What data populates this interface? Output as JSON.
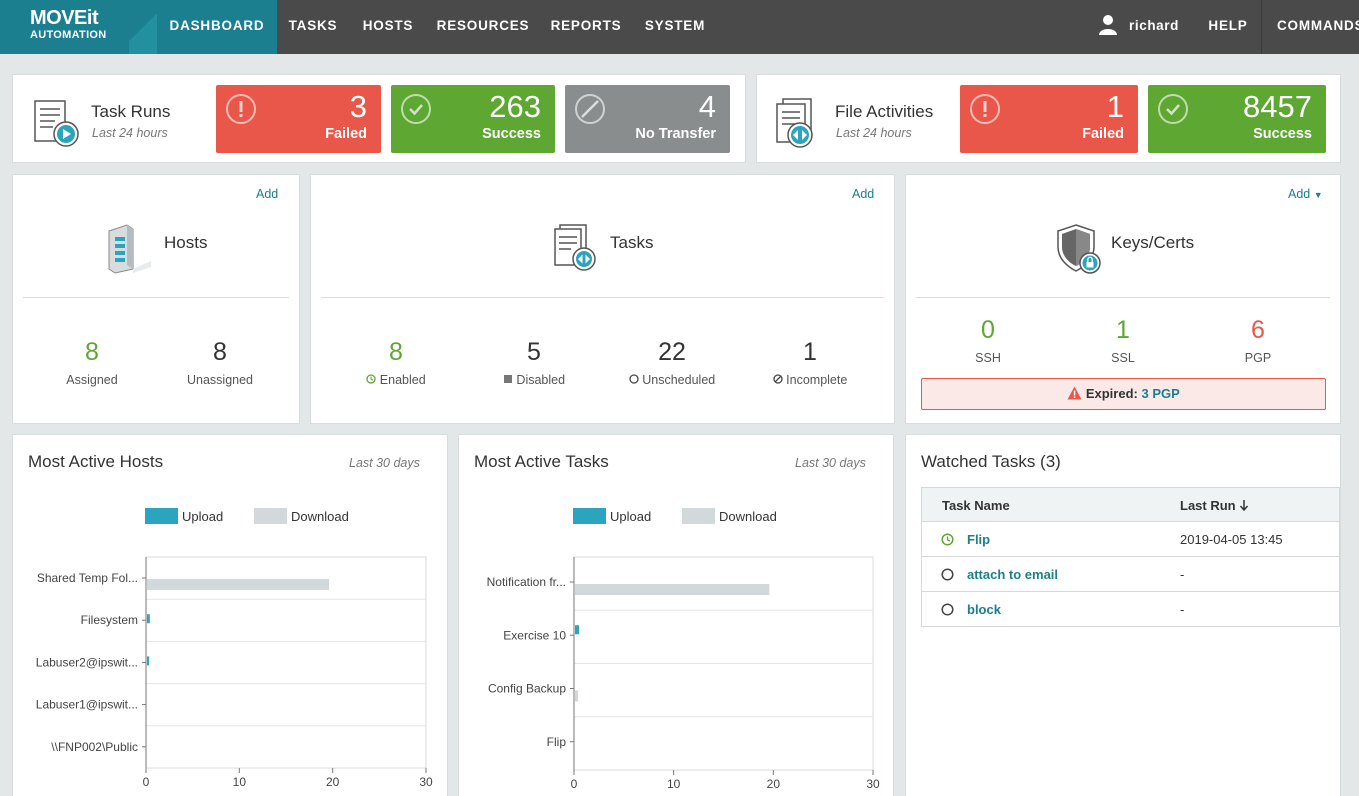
{
  "nav": {
    "logo_top": "MOVEit",
    "logo_bottom": "AUTOMATION",
    "items": [
      "DASHBOARD",
      "TASKS",
      "HOSTS",
      "RESOURCES",
      "REPORTS",
      "SYSTEM"
    ],
    "user": "richard",
    "help": "HELP",
    "commands": "COMMANDS"
  },
  "task_runs": {
    "title": "Task Runs",
    "subtitle": "Last 24 hours",
    "failed": {
      "value": "3",
      "label": "Failed"
    },
    "success": {
      "value": "263",
      "label": "Success"
    },
    "no_transfer": {
      "value": "4",
      "label": "No Transfer"
    }
  },
  "file_activities": {
    "title": "File Activities",
    "subtitle": "Last 24 hours",
    "failed": {
      "value": "1",
      "label": "Failed"
    },
    "success": {
      "value": "8457",
      "label": "Success"
    }
  },
  "hosts": {
    "title": "Hosts",
    "add": "Add",
    "assigned": {
      "value": "8",
      "label": "Assigned"
    },
    "unassigned": {
      "value": "8",
      "label": "Unassigned"
    }
  },
  "tasks": {
    "title": "Tasks",
    "add": "Add",
    "enabled": {
      "value": "8",
      "label": "Enabled"
    },
    "disabled": {
      "value": "5",
      "label": "Disabled"
    },
    "unscheduled": {
      "value": "22",
      "label": "Unscheduled"
    },
    "incomplete": {
      "value": "1",
      "label": "Incomplete"
    }
  },
  "keys": {
    "title": "Keys/Certs",
    "add": "Add",
    "ssh": {
      "value": "0",
      "label": "SSH"
    },
    "ssl": {
      "value": "1",
      "label": "SSL"
    },
    "pgp": {
      "value": "6",
      "label": "PGP"
    },
    "expired_label": "Expired:",
    "expired_link": "3 PGP"
  },
  "most_active_hosts": {
    "title": "Most Active Hosts",
    "range": "Last 30 days",
    "legend_upload": "Upload",
    "legend_download": "Download"
  },
  "most_active_tasks": {
    "title": "Most Active Tasks",
    "range": "Last 30 days",
    "legend_upload": "Upload",
    "legend_download": "Download"
  },
  "watched": {
    "title": "Watched Tasks (3)",
    "col_name": "Task Name",
    "col_last": "Last Run",
    "rows": [
      {
        "name": "Flip",
        "last": "2019-04-05 13:45"
      },
      {
        "name": "attach to email",
        "last": "-"
      },
      {
        "name": "block",
        "last": "-"
      }
    ]
  },
  "colors": {
    "upload": "#2ba4bd",
    "download": "#d3d9db",
    "accent": "#1b7f90"
  },
  "chart_data": [
    {
      "type": "bar",
      "categories": [
        "Shared Temp Fol...",
        "Filesystem",
        "Labuser2@ipswit...",
        "Labuser1@ipswit...",
        "\\\\FNP002\\Public"
      ],
      "series": [
        {
          "name": "Upload",
          "values": [
            0,
            0.3,
            0.2,
            0,
            0
          ]
        },
        {
          "name": "Download",
          "values": [
            19.5,
            0,
            0,
            0,
            0
          ]
        }
      ],
      "xlim": [
        0,
        30
      ],
      "xticks": [
        "0",
        "10",
        "20",
        "30"
      ]
    },
    {
      "type": "bar",
      "categories": [
        "Notification fr...",
        "Exercise 10",
        "Config Backup",
        "Flip"
      ],
      "series": [
        {
          "name": "Upload",
          "values": [
            0,
            0.4,
            0,
            0
          ]
        },
        {
          "name": "Download",
          "values": [
            19.5,
            0,
            0.3,
            0
          ]
        }
      ],
      "xlim": [
        0,
        30
      ],
      "xticks": [
        "0",
        "10",
        "20",
        "30"
      ]
    }
  ]
}
